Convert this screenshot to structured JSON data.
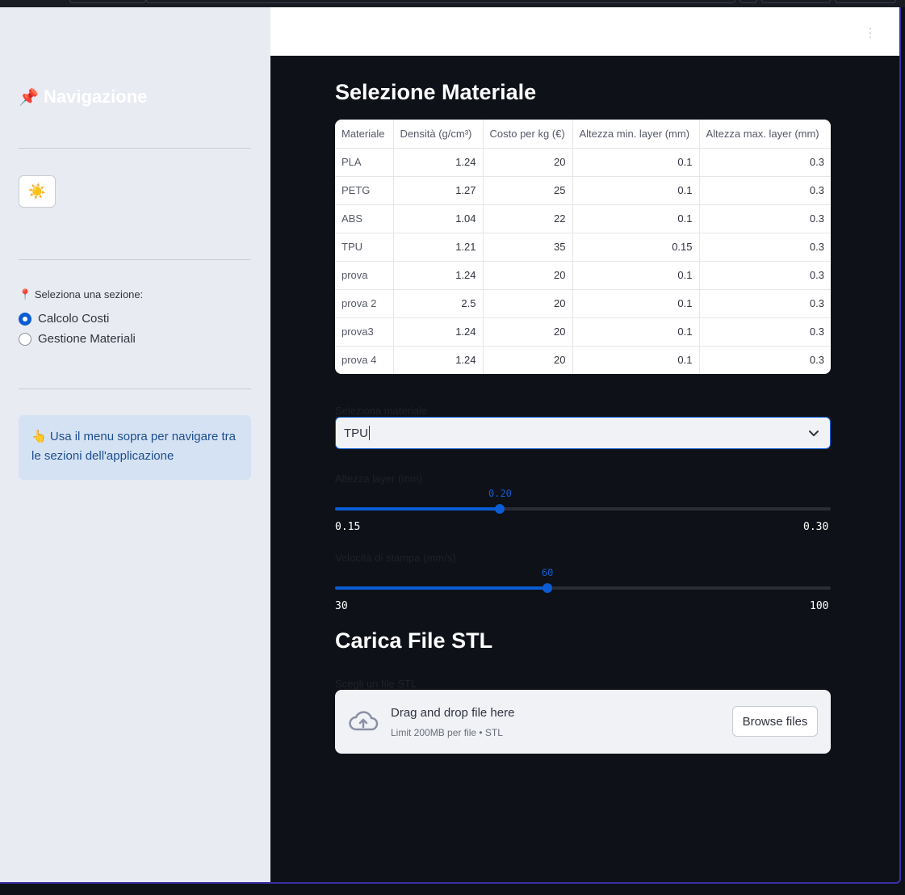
{
  "sidebar": {
    "title": "Navigazione",
    "title_icon": "📌",
    "theme_toggle_icon": "☀️",
    "section_label_icon": "📍",
    "section_label": "Seleziona una sezione:",
    "options": [
      {
        "label": "Calcolo Costi",
        "selected": true
      },
      {
        "label": "Gestione Materiali",
        "selected": false
      }
    ],
    "info_icon": "👆",
    "info_text": "Usa il menu sopra per navigare tra le sezioni dell'applicazione"
  },
  "header": {
    "menu_icon": "⋮"
  },
  "material_section": {
    "title": "Selezione Materiale",
    "table": {
      "columns": [
        "Materiale",
        "Densità (g/cm³)",
        "Costo per kg (€)",
        "Altezza min. layer (mm)",
        "Altezza max. layer (mm)"
      ],
      "rows": [
        [
          "PLA",
          "1.24",
          "20",
          "0.1",
          "0.3"
        ],
        [
          "PETG",
          "1.27",
          "25",
          "0.1",
          "0.3"
        ],
        [
          "ABS",
          "1.04",
          "22",
          "0.1",
          "0.3"
        ],
        [
          "TPU",
          "1.21",
          "35",
          "0.15",
          "0.3"
        ],
        [
          "prova",
          "1.24",
          "20",
          "0.1",
          "0.3"
        ],
        [
          "prova 2",
          "2.5",
          "20",
          "0.1",
          "0.3"
        ],
        [
          "prova3",
          "1.24",
          "20",
          "0.1",
          "0.3"
        ],
        [
          "prova 4",
          "1.24",
          "20",
          "0.1",
          "0.3"
        ]
      ]
    },
    "select": {
      "label": "Seleziona materiale",
      "value": "TPU"
    },
    "layer_slider": {
      "label": "Altezza layer (mm)",
      "value": "0.20",
      "min": "0.15",
      "max": "0.30",
      "fraction": 0.333
    },
    "speed_slider": {
      "label": "Velocità di stampa (mm/s)",
      "value": "60",
      "min": "30",
      "max": "100",
      "fraction": 0.4286
    }
  },
  "upload_section": {
    "title": "Carica File STL",
    "label": "Scegli un file STL",
    "drop_text": "Drag and drop file here",
    "limit_text": "Limit 200MB per file • STL",
    "browse_label": "Browse files"
  },
  "colors": {
    "accent": "#0b5cd5",
    "background": "#0e1117",
    "sidebar": "#e8ebf2"
  }
}
